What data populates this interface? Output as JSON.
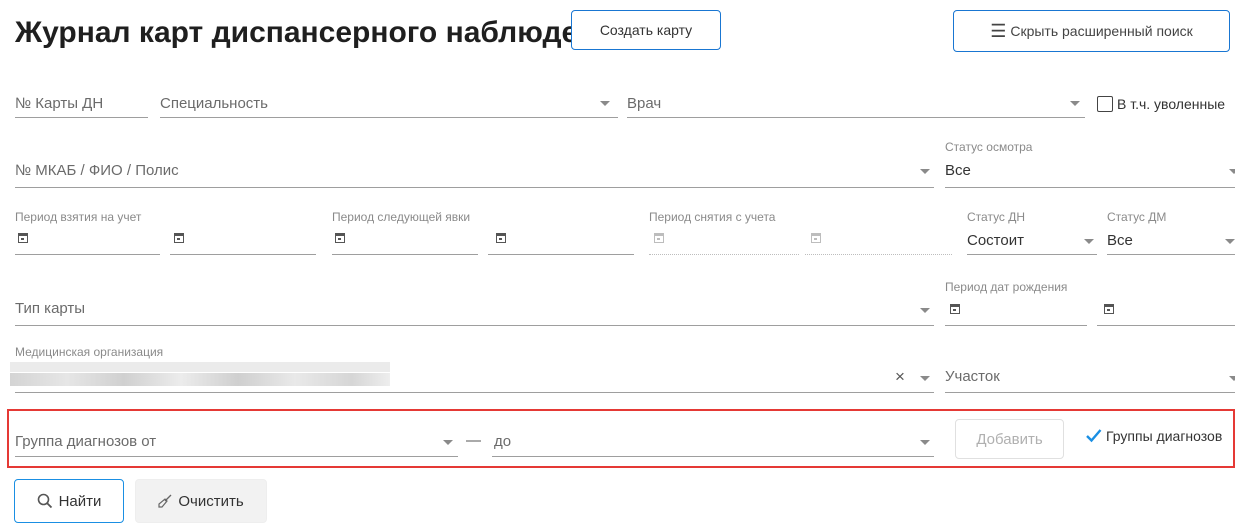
{
  "header": {
    "title": "Журнал карт диспансерного наблюдения",
    "create_label": "Создать карту",
    "hide_search_label": "Скрыть расширенный поиск"
  },
  "row1": {
    "card_number": "№ Карты ДН",
    "specialty": "Специальность",
    "doctor": "Врач",
    "dismissed_label": "В т.ч. уволенные"
  },
  "row2": {
    "patient": "№ МКАБ / ФИО / Полис",
    "exam_status_label": "Статус осмотра",
    "exam_status_value": "Все"
  },
  "row3": {
    "period_reg": "Период взятия на учет",
    "period_next": "Период следующей явки",
    "period_remove": "Период снятия с учета",
    "dn_status_label": "Статус ДН",
    "dn_status_value": "Состоит",
    "dm_status_label": "Статус ДМ",
    "dm_status_value": "Все"
  },
  "row4": {
    "card_type": "Тип карты",
    "birth_period": "Период дат рождения"
  },
  "row5": {
    "med_org_label": "Медицинская организация",
    "district": "Участок"
  },
  "row6": {
    "diag_from": "Группа диагнозов от",
    "dash": "—",
    "diag_to": "до",
    "add_label": "Добавить",
    "groups_label": "Группы диагнозов"
  },
  "actions": {
    "find_label": "Найти",
    "clear_label": "Очистить"
  },
  "colors": {
    "accent": "#1976d2",
    "highlight": "#e53935"
  }
}
